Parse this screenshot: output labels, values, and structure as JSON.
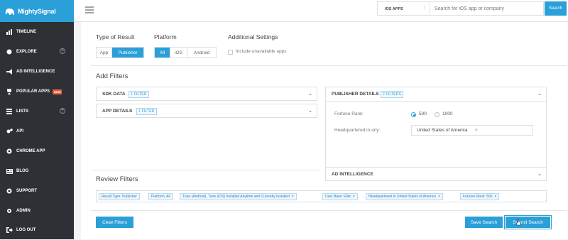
{
  "brand": {
    "name": "MightySignal",
    "accent": "#2a9fd8",
    "sidebar_bg": "#2d3035"
  },
  "sidebar": {
    "items": [
      {
        "label": "TIMELINE",
        "icon": "bar-chart-icon"
      },
      {
        "label": "EXPLORE",
        "icon": "globe-icon",
        "expand": "+"
      },
      {
        "label": "AD INTELLIGENCE",
        "icon": "megaphone-icon"
      },
      {
        "label": "POPULAR APPS",
        "icon": "trophy-icon",
        "badge": "NEW"
      },
      {
        "label": "LISTS",
        "icon": "list-icon",
        "expand": "+"
      },
      {
        "label": "API",
        "icon": "gears-icon"
      },
      {
        "label": "CHROME APP",
        "icon": "chrome-icon"
      },
      {
        "label": "BLOG",
        "icon": "newspaper-icon"
      },
      {
        "label": "SUPPORT",
        "icon": "life-ring-icon"
      },
      {
        "label": "ADMIN",
        "icon": "gear-icon"
      },
      {
        "label": "LOG OUT",
        "icon": "sign-out-icon"
      }
    ]
  },
  "topbar": {
    "platform": "IOS APPS",
    "search_placeholder": "Search for iOS app or company",
    "search_button": "Search"
  },
  "form": {
    "result_type": {
      "label": "Type of Result",
      "options": [
        "App",
        "Publisher"
      ],
      "selected": "Publisher"
    },
    "platform": {
      "label": "Platform",
      "options": [
        "All",
        "iOS",
        "Android"
      ],
      "selected": "All"
    },
    "additional": {
      "label": "Additional Settings",
      "checkbox": "Include unavailable apps",
      "checked": false
    }
  },
  "filters": {
    "title": "Add Filters",
    "sdk": {
      "label": "SDK DATA",
      "badge": "1 FILTER"
    },
    "app": {
      "label": "APP DETAILS",
      "badge": "1 FILTER"
    },
    "publisher": {
      "label": "PUBLISHER DETAILS",
      "badge": "2 FILTERS",
      "fortune_label": "Fortune Rank:",
      "fortune_options": [
        "500",
        "1000"
      ],
      "fortune_selected": "500",
      "hq_label": "Headquartered in any:",
      "hq_value": "United States of America",
      "remove": "×"
    },
    "ad": {
      "label": "AD INTELLIGENCE"
    }
  },
  "review": {
    "title": "Review Filters",
    "remove": "×",
    "tags": [
      "Result Type: Publisher",
      "Platform: All",
      "Tune (Android), Tune (iOS) Installed Anytime and Currently Installed",
      "User Base: Elite",
      "Headquartered in United States of America",
      "Fortune Rank: 500"
    ]
  },
  "buttons": {
    "clear": "Clear Filters",
    "save": "Save Search",
    "submit": "Submit Search"
  }
}
